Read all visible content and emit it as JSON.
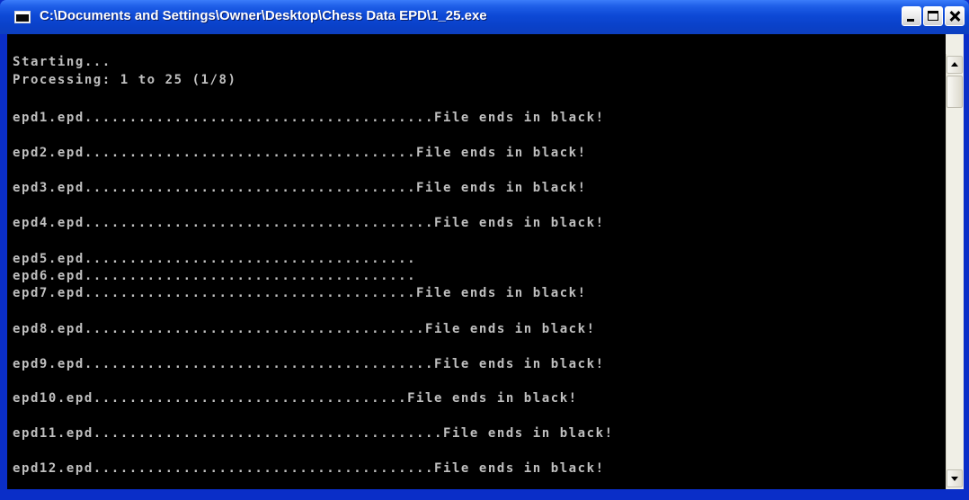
{
  "window": {
    "title": "C:\\Documents and Settings\\Owner\\Desktop\\Chess Data EPD\\1_25.exe"
  },
  "console": {
    "lines": [
      "Starting...",
      "Processing: 1 to 25 (1/8)",
      "epd1.epd.......................................File ends in black!",
      "epd2.epd.....................................File ends in black!",
      "epd3.epd.....................................File ends in black!",
      "epd4.epd.......................................File ends in black!",
      "epd5.epd.....................................",
      "epd6.epd.....................................",
      "epd7.epd.....................................File ends in black!",
      "epd8.epd......................................File ends in black!",
      "epd9.epd.......................................File ends in black!",
      "epd10.epd...................................File ends in black!",
      "epd11.epd.......................................File ends in black!",
      "epd12.epd......................................File ends in black!"
    ]
  },
  "colors": {
    "title_bar": "#0a41c9",
    "console_bg": "#000000",
    "console_text": "#c0c0c0"
  }
}
